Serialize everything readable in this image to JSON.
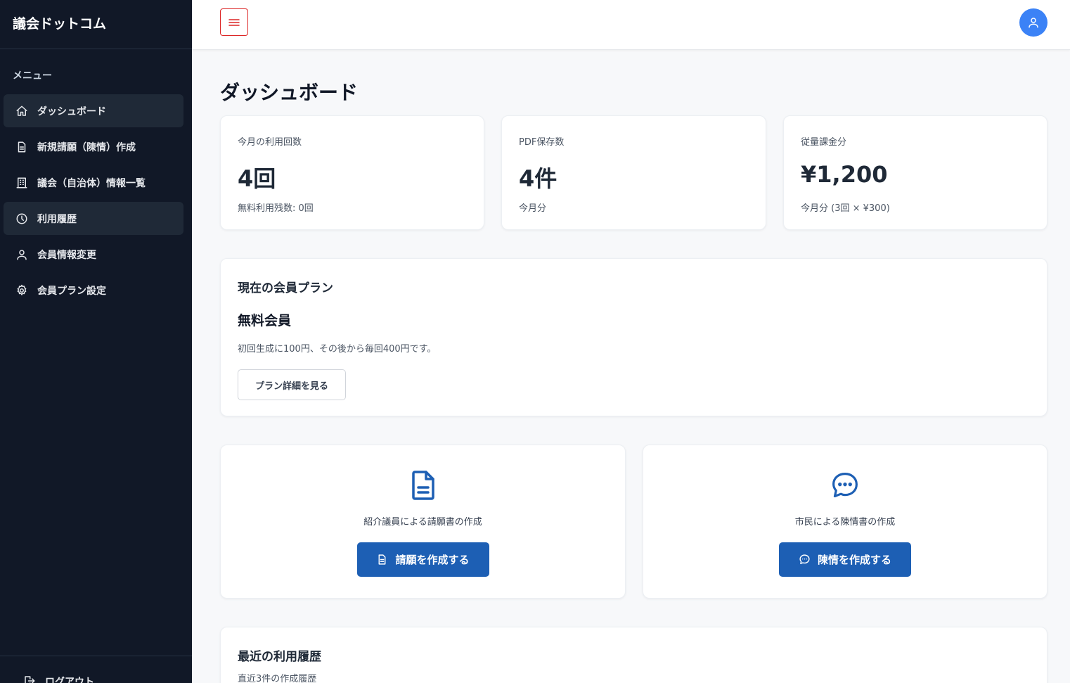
{
  "app": {
    "brand": "議会ドットコム"
  },
  "sidebar": {
    "menu_label": "メニュー",
    "items": [
      {
        "label": "ダッシュボード",
        "icon": "home-icon"
      },
      {
        "label": "新規請願（陳情）作成",
        "icon": "document-icon"
      },
      {
        "label": "議会（自治体）情報一覧",
        "icon": "building-icon"
      },
      {
        "label": "利用履歴",
        "icon": "clock-icon"
      },
      {
        "label": "会員情報変更",
        "icon": "user-icon"
      },
      {
        "label": "会員プラン設定",
        "icon": "gear-icon"
      }
    ],
    "logout_label": "ログアウト"
  },
  "page": {
    "title": "ダッシュボード"
  },
  "stats": [
    {
      "label": "今月の利用回数",
      "value": "4回",
      "sub": "無料利用残数: 0回"
    },
    {
      "label": "PDF保存数",
      "value": "4件",
      "sub": "今月分"
    },
    {
      "label": "従量課金分",
      "value": "¥1,200",
      "sub": "今月分 (3回 × ¥300)"
    }
  ],
  "plan": {
    "section_title": "現在の会員プラン",
    "name": "無料会員",
    "description": "初回生成に100円、その後から毎回400円です。",
    "details_button": "プラン詳細を見る"
  },
  "actions": [
    {
      "description": "紹介議員による請願書の作成",
      "button": "請願を作成する",
      "icon": "document-icon"
    },
    {
      "description": "市民による陳情書の作成",
      "button": "陳情を作成する",
      "icon": "chat-bubble-icon"
    }
  ],
  "recent": {
    "title": "最近の利用履歴",
    "subtitle": "直近3件の作成履歴"
  },
  "colors": {
    "sidebar_bg": "#111827",
    "primary_button": "#1d5fb4",
    "avatar": "#3b82f6",
    "hamburger_border": "#dc2626"
  }
}
